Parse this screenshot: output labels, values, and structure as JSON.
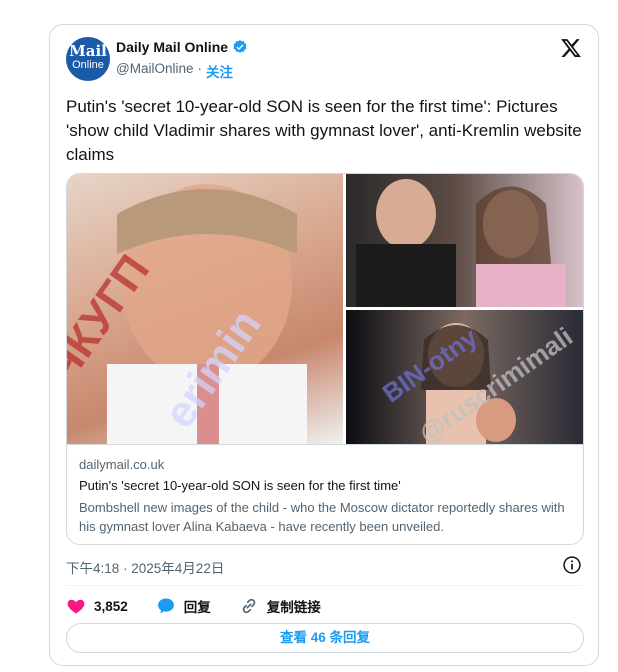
{
  "author": {
    "avatar_line1": "Mail",
    "avatar_line2": "Online",
    "name": "Daily Mail Online",
    "handle": "@MailOnline",
    "separator": "·",
    "follow_label": "关注"
  },
  "tweet": {
    "text": "Putin's 'secret 10-year-old SON is seen for the first time': Pictures 'show child Vladimir shares with gymnast lover', anti-Kremlin website claims",
    "timestamp": "下午4:18 · 2025年4月22日"
  },
  "media_card": {
    "watermarks": [
      "ЧКУГП",
      "erimin",
      "BIN-otny",
      "@ruscrimimali"
    ],
    "domain": "dailymail.co.uk",
    "title": "Putin's 'secret 10-year-old SON is seen for the first time'",
    "description": "Bombshell new images of the child - who the Moscow dictator reportedly shares with his gymnast lover Alina Kabaeva - have recently been unveiled."
  },
  "actions": {
    "like_count": "3,852",
    "reply_label": "回复",
    "copy_link_label": "复制链接"
  },
  "view_replies_label": "查看 46 条回复",
  "icons": {
    "verified": "verified-badge-icon",
    "x_logo": "x-logo-icon",
    "info": "info-icon",
    "like": "heart-icon",
    "reply": "speech-bubble-icon",
    "link": "link-icon"
  },
  "colors": {
    "accent": "#1d9bf0",
    "like": "#f91880",
    "text_secondary": "#536471",
    "border": "#cfd9de"
  }
}
